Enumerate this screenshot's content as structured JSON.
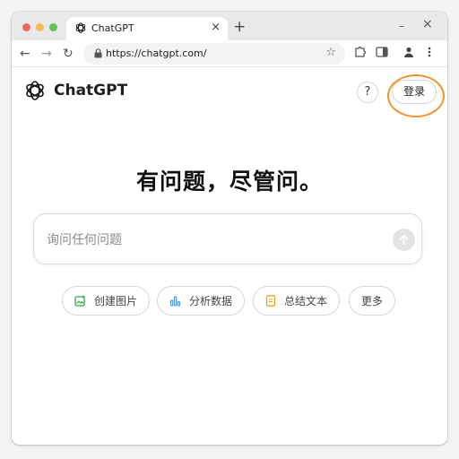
{
  "browser": {
    "tab_title": "ChatGPT",
    "tab_close": "×",
    "new_tab": "+",
    "url": "https://chatgpt.com/",
    "minimize": "–",
    "close": "×"
  },
  "header": {
    "brand_name": "ChatGPT",
    "help_label": "?",
    "login_label": "登录"
  },
  "main": {
    "headline": "有问题，尽管问。",
    "prompt_placeholder": "询问任何问题"
  },
  "chips": [
    {
      "label": "创建图片",
      "icon": "image-plus-icon",
      "color": "#35a852"
    },
    {
      "label": "分析数据",
      "icon": "bar-chart-icon",
      "color": "#4a8fe0"
    },
    {
      "label": "总结文本",
      "icon": "document-icon",
      "color": "#f0a020"
    },
    {
      "label": "更多",
      "icon": "",
      "color": ""
    }
  ],
  "colors": {
    "highlight": "#f0952d",
    "traffic_red": "#ee6a5f",
    "traffic_yellow": "#f5bd4f",
    "traffic_green": "#61c454"
  }
}
